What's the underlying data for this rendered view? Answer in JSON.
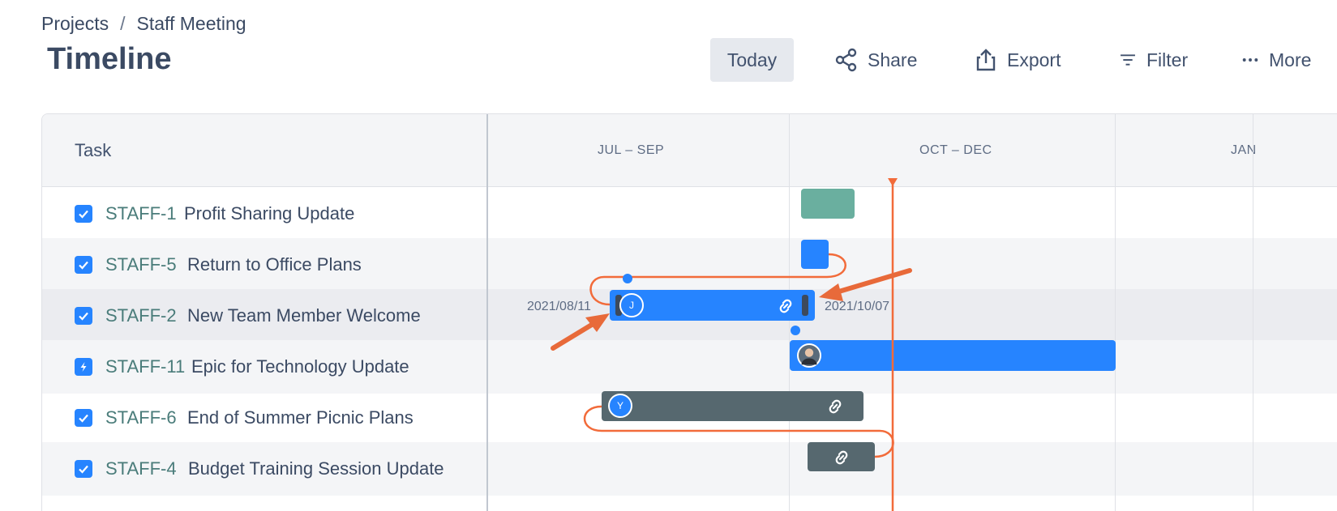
{
  "breadcrumb": {
    "projects": "Projects",
    "separator": "/",
    "current": "Staff Meeting"
  },
  "page_title": "Timeline",
  "toolbar": {
    "today": "Today",
    "share": "Share",
    "export": "Export",
    "filter": "Filter",
    "more": "More"
  },
  "table": {
    "task_header": "Task",
    "columns": [
      "JUL – SEP",
      "OCT – DEC",
      "JAN"
    ],
    "rows": [
      {
        "key": "STAFF-1",
        "summary": "Profit Sharing Update",
        "type": "task"
      },
      {
        "key": "STAFF-5",
        "summary": "Return to Office Plans",
        "type": "task"
      },
      {
        "key": "STAFF-2",
        "summary": "New Team Member Welcome",
        "type": "task"
      },
      {
        "key": "STAFF-11",
        "summary": "Epic for Technology Update",
        "type": "epic"
      },
      {
        "key": "STAFF-6",
        "summary": "End of Summer Picnic Plans",
        "type": "task"
      },
      {
        "key": "STAFF-4",
        "summary": "Budget Training Session Update",
        "type": "task"
      }
    ]
  },
  "bars": {
    "staff2_start_date": "2021/08/11",
    "staff2_end_date": "2021/10/07",
    "staff2_avatar": "J",
    "staff6_avatar": "Y"
  },
  "colors": {
    "blue": "#2684ff",
    "teal": "#6aaf9f",
    "slate": "#56686f",
    "today_line": "#f26b3a",
    "arrow": "#e86a3a"
  }
}
